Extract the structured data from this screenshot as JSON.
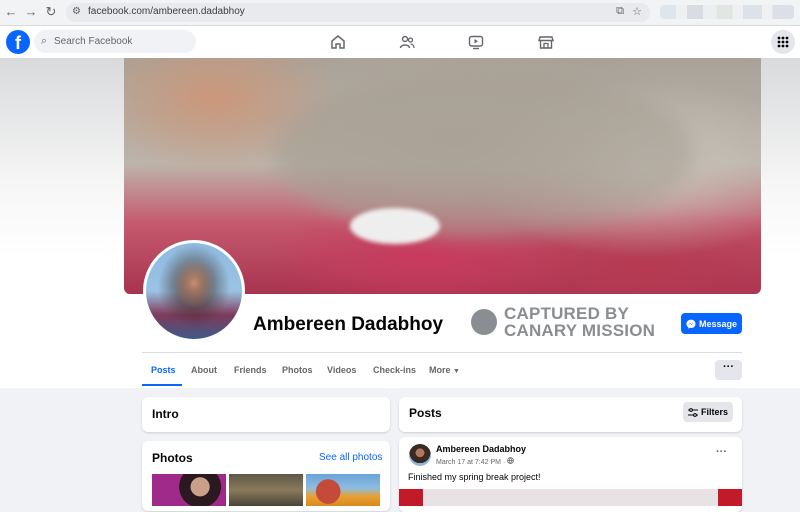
{
  "browser": {
    "url": "facebook.com/ambereen.dadabhoy",
    "icons": [
      "back-icon",
      "forward-icon",
      "reload-icon",
      "site-settings-icon",
      "install-app-icon",
      "bookmark-star-icon"
    ]
  },
  "topbar": {
    "logo_letter": "f",
    "search_placeholder": "Search Facebook",
    "nav_icons": [
      "home-icon",
      "friends-icon",
      "watch-icon",
      "marketplace-icon"
    ],
    "menu_icon": "grid-menu-icon"
  },
  "profile": {
    "name": "Ambereen Dadabhoy",
    "watermark": {
      "line1": "CAPTURED BY",
      "line2": "CANARY MISSION"
    },
    "message_button": "Message",
    "tabs": [
      "Posts",
      "About",
      "Friends",
      "Photos",
      "Videos",
      "Check-ins",
      "More"
    ],
    "active_tab": "Posts",
    "more_button": "···"
  },
  "intro": {
    "title": "Intro"
  },
  "photos": {
    "title": "Photos",
    "link": "See all photos"
  },
  "posts": {
    "title": "Posts",
    "filters_button": "Filters",
    "items": [
      {
        "author": "Ambereen Dadabhoy",
        "date": "March 17 at 7:42 PM",
        "audience_icon": "globe-icon",
        "text": "Finished my spring break project!"
      }
    ]
  },
  "colors": {
    "brand": "#0866ff",
    "background": "#f0f2f5",
    "secondary_text": "#65676b"
  }
}
